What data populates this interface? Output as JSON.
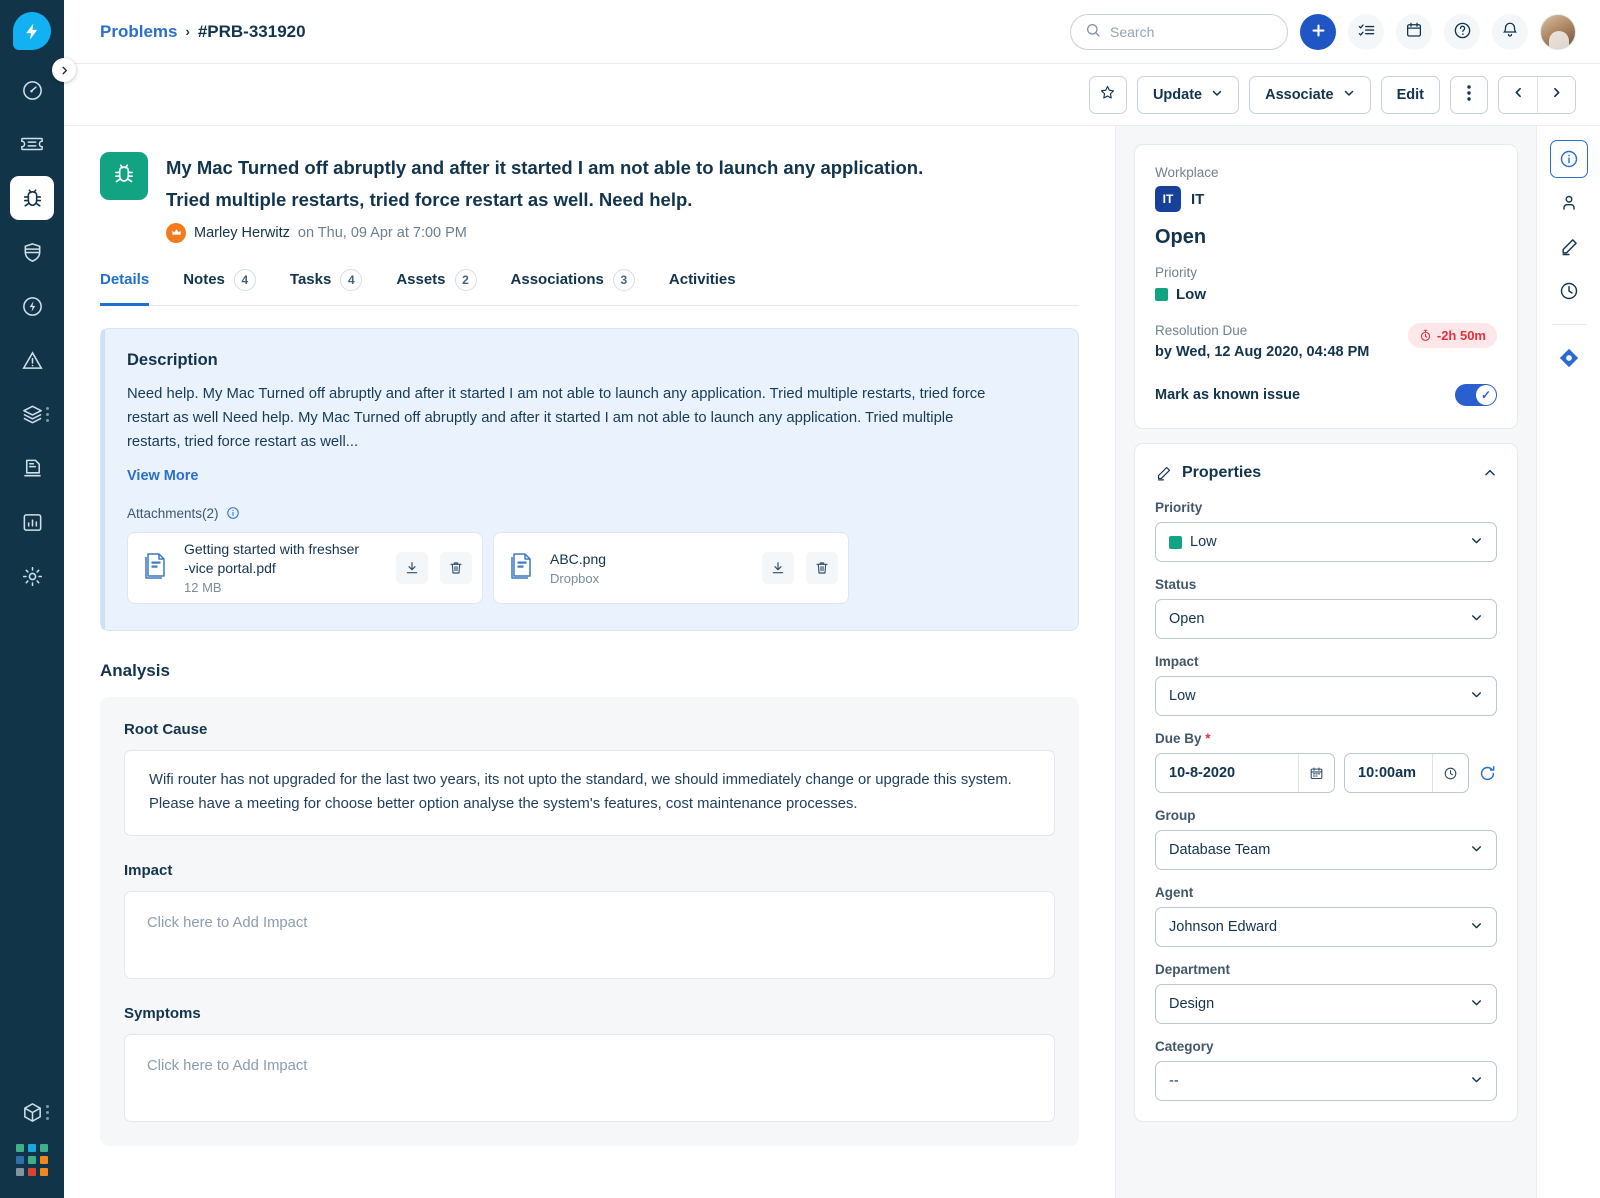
{
  "colors": {
    "rail_bg": "#123449",
    "logo_blue": "#12b2f2",
    "accent_blue": "#2c6ecb",
    "primary_blue": "#1f56c3",
    "bug_green": "#12a482",
    "priority_low": "#12a482",
    "sla_red": "#e0323f",
    "desc_bg": "#e9f2fd",
    "panel_bg": "#f5f7f9"
  },
  "sidebar": {
    "logo_name": "lightning-bolt-logo",
    "items": [
      {
        "name": "dashboard",
        "icon": "gauge-icon",
        "active": false
      },
      {
        "name": "tickets",
        "icon": "ticket-icon",
        "active": false
      },
      {
        "name": "problems",
        "icon": "bug-icon",
        "active": true
      },
      {
        "name": "changes",
        "icon": "shield-icon",
        "active": false
      },
      {
        "name": "releases",
        "icon": "bolt-circle-icon",
        "active": false
      },
      {
        "name": "incidents",
        "icon": "warning-triangle-icon",
        "active": false
      },
      {
        "name": "assets",
        "icon": "layers-icon",
        "active": false
      },
      {
        "name": "knowledge",
        "icon": "document-stack-icon",
        "active": false
      },
      {
        "name": "analytics",
        "icon": "bar-chart-icon",
        "active": false
      },
      {
        "name": "admin",
        "icon": "gear-icon",
        "active": false
      }
    ],
    "bottom_item": {
      "name": "marketplace",
      "icon": "cube-icon"
    },
    "collapse_icon": "chevron-right-icon"
  },
  "topbar": {
    "breadcrumb": {
      "parent": "Problems",
      "separator": "›",
      "current": "#PRB-331920"
    },
    "search": {
      "placeholder": "Search",
      "value": "",
      "icon": "search-icon"
    },
    "actions": [
      {
        "name": "add-new-button",
        "icon": "plus-icon"
      },
      {
        "name": "tasks-button",
        "icon": "checklist-icon"
      },
      {
        "name": "calendar-button",
        "icon": "calendar-icon"
      },
      {
        "name": "help-button",
        "icon": "question-circle-icon"
      },
      {
        "name": "notifications-button",
        "icon": "bell-icon"
      }
    ],
    "avatar_alt": "user-avatar"
  },
  "actionbar": {
    "favorite_icon": "star-icon",
    "update_label": "Update",
    "associate_label": "Associate",
    "edit_label": "Edit",
    "more_icon": "kebab-menu-icon",
    "prev_icon": "chevron-left-icon",
    "next_icon": "chevron-right-icon"
  },
  "ticket": {
    "type_icon": "bug-icon",
    "title_line1": "My Mac Turned off abruptly and after it started I am not able to launch any application.",
    "title_line2": "Tried multiple restarts, tried force restart as well. Need help.",
    "author": "Marley Herwitz",
    "author_badge_icon": "crown-icon",
    "timestamp": "on Thu, 09 Apr at 7:00 PM"
  },
  "tabs": [
    {
      "label": "Details",
      "count": "",
      "active": true
    },
    {
      "label": "Notes",
      "count": "4",
      "active": false
    },
    {
      "label": "Tasks",
      "count": "4",
      "active": false
    },
    {
      "label": "Assets",
      "count": "2",
      "active": false
    },
    {
      "label": "Associations",
      "count": "3",
      "active": false
    },
    {
      "label": "Activities",
      "count": "",
      "active": false
    }
  ],
  "description": {
    "heading": "Description",
    "text": "Need help. My Mac Turned off abruptly and after it started I am not able to launch any application. Tried multiple restarts, tried force restart as well Need help. My Mac Turned off abruptly and after it started I am not able to launch any application. Tried multiple restarts, tried force restart as well...",
    "view_more": "View More",
    "attachments_label": "Attachments(2)",
    "info_icon": "info-circle-icon",
    "attachments": [
      {
        "name": "Getting started with freshser\n-vice portal.pdf",
        "sub": "12 MB",
        "file_icon": "document-icon",
        "download_icon": "download-icon",
        "delete_icon": "trash-icon"
      },
      {
        "name": "ABC.png",
        "sub": "Dropbox",
        "file_icon": "document-icon",
        "download_icon": "download-icon",
        "delete_icon": "trash-icon"
      }
    ]
  },
  "analysis": {
    "heading": "Analysis",
    "root_cause_label": "Root Cause",
    "root_cause_text": "Wifi router has not upgraded for the last two years, its not upto the standard, we should immediately change or upgrade this system. Please have a meeting for choose better option analyse the system's features, cost maintenance processes.",
    "impact_label": "Impact",
    "impact_placeholder": "Click here to Add Impact",
    "symptoms_label": "Symptoms",
    "symptoms_placeholder": "Click here to Add Impact"
  },
  "summary": {
    "workplace_label": "Workplace",
    "workplace_badge": "IT",
    "workplace_name": "IT",
    "state": "Open",
    "priority_label": "Priority",
    "priority_value": "Low",
    "priority_color": "#12a482",
    "resolution_label": "Resolution Due",
    "resolution_date": "by Wed, 12 Aug 2020, 04:48 PM",
    "sla_badge": "-2h 50m",
    "sla_icon": "stopwatch-icon",
    "known_issue_label": "Mark as known issue",
    "known_issue_on": true
  },
  "properties": {
    "heading": "Properties",
    "edit_icon": "pencil-icon",
    "collapse_icon": "chevron-up-icon",
    "fields": [
      {
        "label": "Priority",
        "value": "Low",
        "swatch": "#12a482",
        "required": false,
        "name": "priority"
      },
      {
        "label": "Status",
        "value": "Open",
        "swatch": "",
        "required": false,
        "name": "status"
      },
      {
        "label": "Impact",
        "value": "Low",
        "swatch": "",
        "required": false,
        "name": "impact"
      }
    ],
    "due_by": {
      "label": "Due By",
      "required": true,
      "date": "10-8-2020",
      "time": "10:00am",
      "date_icon": "calendar-icon",
      "time_icon": "clock-icon",
      "reset_icon": "refresh-icon"
    },
    "fields2": [
      {
        "label": "Group",
        "value": "Database Team",
        "name": "group"
      },
      {
        "label": "Agent",
        "value": "Johnson Edward",
        "name": "agent"
      },
      {
        "label": "Department",
        "value": "Design",
        "name": "department"
      },
      {
        "label": "Category",
        "value": "--",
        "name": "category"
      }
    ]
  },
  "iconrail": [
    {
      "name": "info-icon",
      "active": true
    },
    {
      "name": "requester-icon",
      "active": false
    },
    {
      "name": "pencil-icon",
      "active": false
    },
    {
      "name": "clock-history-icon",
      "active": false
    },
    {
      "name": "jira-diamond-icon",
      "active": false
    }
  ]
}
